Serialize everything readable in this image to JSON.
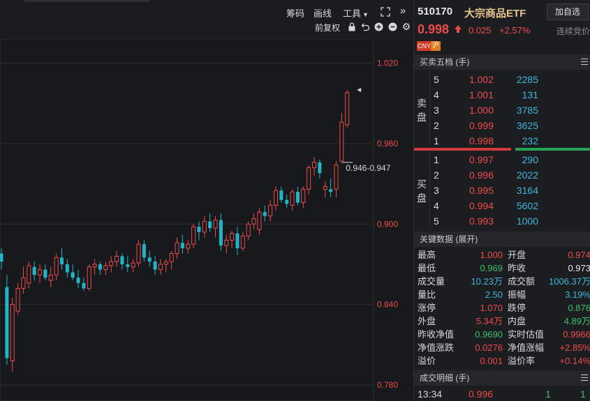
{
  "toolbar": {
    "chips_label": "筹码",
    "drawline_label": "画线",
    "tools_label": "工具",
    "adjust_label": "前复权"
  },
  "chart": {
    "y_ticks": [
      "1.020",
      "0.960",
      "0.900",
      "0.840",
      "0.780"
    ],
    "range_label": "0.946-0.947"
  },
  "chart_data": {
    "type": "candlestick",
    "ylim": [
      0.768,
      1.038
    ],
    "y_ticks": [
      1.02,
      0.96,
      0.9,
      0.84,
      0.78
    ],
    "candles": [
      {
        "o": 0.878,
        "h": 0.882,
        "l": 0.866,
        "c": 0.872
      },
      {
        "o": 0.853,
        "h": 0.862,
        "l": 0.795,
        "c": 0.8
      },
      {
        "o": 0.798,
        "h": 0.845,
        "l": 0.79,
        "c": 0.84
      },
      {
        "o": 0.835,
        "h": 0.856,
        "l": 0.832,
        "c": 0.852
      },
      {
        "o": 0.852,
        "h": 0.868,
        "l": 0.848,
        "c": 0.86
      },
      {
        "o": 0.856,
        "h": 0.872,
        "l": 0.852,
        "c": 0.869
      },
      {
        "o": 0.868,
        "h": 0.872,
        "l": 0.858,
        "c": 0.862
      },
      {
        "o": 0.862,
        "h": 0.87,
        "l": 0.856,
        "c": 0.866
      },
      {
        "o": 0.866,
        "h": 0.87,
        "l": 0.858,
        "c": 0.86
      },
      {
        "o": 0.858,
        "h": 0.868,
        "l": 0.853,
        "c": 0.862
      },
      {
        "o": 0.862,
        "h": 0.878,
        "l": 0.858,
        "c": 0.875
      },
      {
        "o": 0.875,
        "h": 0.882,
        "l": 0.866,
        "c": 0.87
      },
      {
        "o": 0.87,
        "h": 0.874,
        "l": 0.86,
        "c": 0.864
      },
      {
        "o": 0.864,
        "h": 0.87,
        "l": 0.858,
        "c": 0.86
      },
      {
        "o": 0.86,
        "h": 0.866,
        "l": 0.852,
        "c": 0.856
      },
      {
        "o": 0.856,
        "h": 0.86,
        "l": 0.85,
        "c": 0.852
      },
      {
        "o": 0.852,
        "h": 0.87,
        "l": 0.85,
        "c": 0.868
      },
      {
        "o": 0.868,
        "h": 0.874,
        "l": 0.862,
        "c": 0.87
      },
      {
        "o": 0.87,
        "h": 0.872,
        "l": 0.862,
        "c": 0.866
      },
      {
        "o": 0.866,
        "h": 0.872,
        "l": 0.862,
        "c": 0.869
      },
      {
        "o": 0.869,
        "h": 0.876,
        "l": 0.864,
        "c": 0.872
      },
      {
        "o": 0.872,
        "h": 0.88,
        "l": 0.868,
        "c": 0.876
      },
      {
        "o": 0.876,
        "h": 0.878,
        "l": 0.866,
        "c": 0.87
      },
      {
        "o": 0.87,
        "h": 0.876,
        "l": 0.864,
        "c": 0.868
      },
      {
        "o": 0.868,
        "h": 0.874,
        "l": 0.864,
        "c": 0.871
      },
      {
        "o": 0.871,
        "h": 0.888,
        "l": 0.868,
        "c": 0.885
      },
      {
        "o": 0.885,
        "h": 0.888,
        "l": 0.872,
        "c": 0.875
      },
      {
        "o": 0.875,
        "h": 0.88,
        "l": 0.868,
        "c": 0.872
      },
      {
        "o": 0.872,
        "h": 0.876,
        "l": 0.862,
        "c": 0.866
      },
      {
        "o": 0.866,
        "h": 0.874,
        "l": 0.862,
        "c": 0.87
      },
      {
        "o": 0.87,
        "h": 0.874,
        "l": 0.864,
        "c": 0.872
      },
      {
        "o": 0.872,
        "h": 0.88,
        "l": 0.866,
        "c": 0.878
      },
      {
        "o": 0.878,
        "h": 0.89,
        "l": 0.874,
        "c": 0.886
      },
      {
        "o": 0.886,
        "h": 0.892,
        "l": 0.878,
        "c": 0.882
      },
      {
        "o": 0.882,
        "h": 0.888,
        "l": 0.878,
        "c": 0.885
      },
      {
        "o": 0.885,
        "h": 0.9,
        "l": 0.882,
        "c": 0.898
      },
      {
        "o": 0.898,
        "h": 0.902,
        "l": 0.888,
        "c": 0.894
      },
      {
        "o": 0.894,
        "h": 0.906,
        "l": 0.89,
        "c": 0.902
      },
      {
        "o": 0.902,
        "h": 0.908,
        "l": 0.894,
        "c": 0.897
      },
      {
        "o": 0.897,
        "h": 0.906,
        "l": 0.89,
        "c": 0.903
      },
      {
        "o": 0.903,
        "h": 0.908,
        "l": 0.88,
        "c": 0.884
      },
      {
        "o": 0.884,
        "h": 0.892,
        "l": 0.878,
        "c": 0.888
      },
      {
        "o": 0.888,
        "h": 0.895,
        "l": 0.882,
        "c": 0.893
      },
      {
        "o": 0.893,
        "h": 0.898,
        "l": 0.877,
        "c": 0.882
      },
      {
        "o": 0.882,
        "h": 0.894,
        "l": 0.88,
        "c": 0.891
      },
      {
        "o": 0.891,
        "h": 0.902,
        "l": 0.888,
        "c": 0.9
      },
      {
        "o": 0.9,
        "h": 0.908,
        "l": 0.896,
        "c": 0.904
      },
      {
        "o": 0.896,
        "h": 0.912,
        "l": 0.892,
        "c": 0.909
      },
      {
        "o": 0.909,
        "h": 0.914,
        "l": 0.902,
        "c": 0.906
      },
      {
        "o": 0.906,
        "h": 0.918,
        "l": 0.902,
        "c": 0.914
      },
      {
        "o": 0.914,
        "h": 0.928,
        "l": 0.91,
        "c": 0.925
      },
      {
        "o": 0.925,
        "h": 0.928,
        "l": 0.916,
        "c": 0.918
      },
      {
        "o": 0.918,
        "h": 0.922,
        "l": 0.912,
        "c": 0.915
      },
      {
        "o": 0.914,
        "h": 0.926,
        "l": 0.91,
        "c": 0.924
      },
      {
        "o": 0.924,
        "h": 0.928,
        "l": 0.914,
        "c": 0.916
      },
      {
        "o": 0.916,
        "h": 0.928,
        "l": 0.912,
        "c": 0.926
      },
      {
        "o": 0.926,
        "h": 0.944,
        "l": 0.922,
        "c": 0.942
      },
      {
        "o": 0.942,
        "h": 0.95,
        "l": 0.936,
        "c": 0.946
      },
      {
        "o": 0.946,
        "h": 0.948,
        "l": 0.934,
        "c": 0.938
      },
      {
        "o": 0.926,
        "h": 0.932,
        "l": 0.92,
        "c": 0.928
      },
      {
        "o": 0.926,
        "h": 0.934,
        "l": 0.92,
        "c": 0.924
      },
      {
        "o": 0.926,
        "h": 0.947,
        "l": 0.92,
        "c": 0.944
      },
      {
        "o": 0.947,
        "h": 0.983,
        "l": 0.946,
        "c": 0.976
      },
      {
        "o": 0.974,
        "h": 1.0,
        "l": 0.972,
        "c": 0.998
      }
    ]
  },
  "header": {
    "code": "510170",
    "name": "大宗商品ETF",
    "add_watch_label": "加自选",
    "price": "0.998",
    "change": "0.025",
    "change_pct": "+2.57%",
    "status": "连续竞价",
    "badge_cny": "CNY",
    "badge_market": "沪"
  },
  "orderbook": {
    "title": "买卖五档 (手)",
    "sell_label_1": "卖",
    "sell_label_2": "盘",
    "buy_label_1": "买",
    "buy_label_2": "盘",
    "asks": [
      {
        "level": "5",
        "price": "1.002",
        "qty": "2285"
      },
      {
        "level": "4",
        "price": "1.001",
        "qty": "131"
      },
      {
        "level": "3",
        "price": "1.000",
        "qty": "3785"
      },
      {
        "level": "2",
        "price": "0.999",
        "qty": "3625"
      },
      {
        "level": "1",
        "price": "0.998",
        "qty": "232"
      }
    ],
    "bids": [
      {
        "level": "1",
        "price": "0.997",
        "qty": "290"
      },
      {
        "level": "2",
        "price": "0.996",
        "qty": "2022"
      },
      {
        "level": "3",
        "price": "0.995",
        "qty": "3164"
      },
      {
        "level": "4",
        "price": "0.994",
        "qty": "5602"
      },
      {
        "level": "5",
        "price": "0.993",
        "qty": "1000"
      }
    ],
    "ratio_bar": {
      "sell_fraction": 0.56
    }
  },
  "keydata": {
    "title": "关键数据 (展开)",
    "rows": [
      {
        "l1": "最高",
        "v1": "1.000",
        "c1": "red",
        "l2": "开盘",
        "v2": "0.974",
        "c2": "red"
      },
      {
        "l1": "最低",
        "v1": "0.969",
        "c1": "green",
        "l2": "昨收",
        "v2": "0.973",
        "c2": "white"
      },
      {
        "l1": "成交量",
        "v1": "10.23万",
        "c1": "cyan",
        "l2": "成交额",
        "v2": "1006.37万",
        "c2": "cyan"
      },
      {
        "l1": "量比",
        "v1": "2.50",
        "c1": "cyan",
        "l2": "振幅",
        "v2": "3.19%",
        "c2": "cyan"
      },
      {
        "l1": "涨停",
        "v1": "1.070",
        "c1": "red",
        "l2": "跌停",
        "v2": "0.876",
        "c2": "green"
      },
      {
        "l1": "外盘",
        "v1": "5.34万",
        "c1": "red",
        "l2": "内盘",
        "v2": "4.89万",
        "c2": "green"
      },
      {
        "l1": "昨收净值",
        "v1": "0.9690",
        "c1": "green",
        "l2": "实时估值",
        "v2": "0.9966",
        "c2": "red"
      },
      {
        "l1": "净值涨跌",
        "v1": "0.0276",
        "c1": "red",
        "l2": "净值涨幅",
        "v2": "+2.85%",
        "c2": "red"
      },
      {
        "l1": "溢价",
        "v1": "0.001",
        "c1": "red",
        "l2": "溢价率",
        "v2": "+0.14%",
        "c2": "red"
      }
    ]
  },
  "trades": {
    "title": "成交明细 (手)",
    "row": {
      "time": "13:34",
      "price": "0.996",
      "qty": "1",
      "extra": "1"
    }
  },
  "colors": {
    "up": "#f04b4b",
    "down": "#22b5c7",
    "bg": "#18191c",
    "grid": "#2b2d31"
  }
}
